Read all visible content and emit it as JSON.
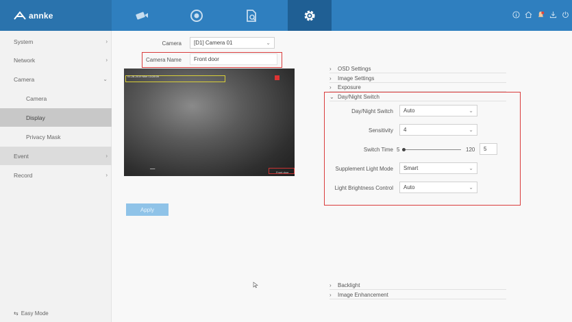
{
  "brand": {
    "name": "annke"
  },
  "topbar": {
    "nav": [
      {
        "name": "live-view",
        "icon": "camera-icon"
      },
      {
        "name": "playback",
        "icon": "playback-icon"
      },
      {
        "name": "search",
        "icon": "file-search-icon"
      },
      {
        "name": "configuration",
        "icon": "gear-icon",
        "active": true
      }
    ],
    "right_icons": [
      "info-icon",
      "home-icon",
      "alert-icon",
      "download-icon",
      "power-icon"
    ]
  },
  "sidebar": {
    "items": [
      {
        "label": "System"
      },
      {
        "label": "Network"
      },
      {
        "label": "Camera"
      },
      {
        "label": "Camera"
      },
      {
        "label": "Display"
      },
      {
        "label": "Privacy Mask"
      },
      {
        "label": "Event"
      },
      {
        "label": "Record"
      }
    ],
    "easy_mode": "Easy Mode"
  },
  "form": {
    "camera_label": "Camera",
    "camera_value": "[D1] Camera 01",
    "camera_name_label": "Camera Name",
    "camera_name_value": "Front door"
  },
  "preview": {
    "osd_text": "01-28-2019 Mon 13:28:09",
    "camera_text": "Front door"
  },
  "apply_label": "Apply",
  "sections": {
    "osd": "OSD Settings",
    "image": "Image Settings",
    "exposure": "Exposure",
    "day_night": "Day/Night Switch",
    "backlight": "Backlight",
    "enhancement": "Image Enhancement"
  },
  "day_night": {
    "switch_label": "Day/Night Switch",
    "switch_value": "Auto",
    "sensitivity_label": "Sensitivity",
    "sensitivity_value": "4",
    "switch_time_label": "Switch Time",
    "switch_time_min": "5",
    "switch_time_max": "120",
    "switch_time_value": "5",
    "supplement_label": "Supplement Light Mode",
    "supplement_value": "Smart",
    "brightness_label": "Light Brightness Control",
    "brightness_value": "Auto"
  },
  "colors": {
    "topbar": "#2f7fbf",
    "brand_bg": "#2a73ad",
    "active_nav": "#1f5f94",
    "highlight_red": "#d93a3a",
    "apply_button": "#8fc3e8"
  }
}
